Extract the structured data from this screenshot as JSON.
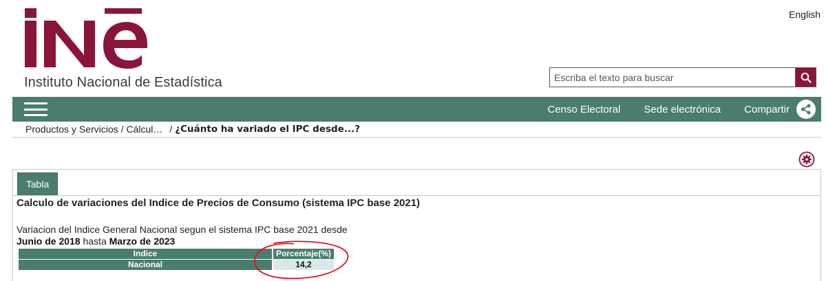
{
  "header": {
    "language_link": "English",
    "logo_text": "INē",
    "logo_subtitle": "Instituto Nacional de Estadística",
    "search_placeholder": "Escriba el texto para buscar",
    "brand_color": "#8b1538"
  },
  "navbar": {
    "links": [
      "Censo Electoral",
      "Sede electrónica",
      "Compartir"
    ],
    "color": "#4a7c6f"
  },
  "breadcrumb": {
    "items": [
      "Productos y Servicios",
      "Cálcul…"
    ],
    "current": "¿Cuánto ha variado el IPC desde...?"
  },
  "tabs": [
    "Tabla"
  ],
  "content": {
    "title": "Calculo de variaciones del Indice de Precios de Consumo (sistema IPC base 2021)",
    "description": "Variacion del Indice General Nacional segun el sistema IPC base 2021 desde",
    "from_date": "Junio de 2018",
    "connector": "hasta",
    "to_date": "Marzo de 2023"
  },
  "table": {
    "headers": [
      "Indice",
      "Porcentaje(%)"
    ],
    "rows": [
      {
        "label": "Nacional",
        "value": "14,2"
      }
    ]
  }
}
